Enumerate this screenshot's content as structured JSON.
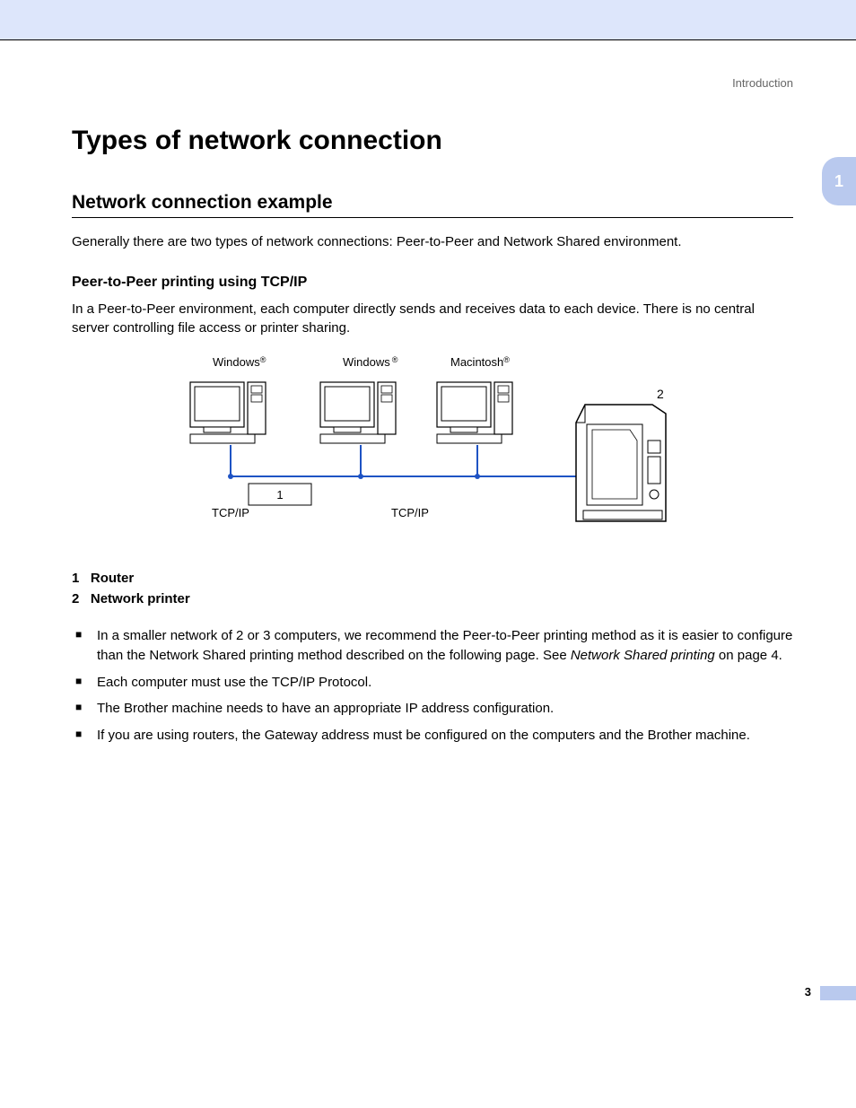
{
  "header": {
    "breadcrumb": "Introduction"
  },
  "side_tab": "1",
  "title": "Types of network connection",
  "section": {
    "heading": "Network connection example",
    "intro": "Generally there are two types of network connections: Peer-to-Peer and Network Shared environment."
  },
  "subsection": {
    "heading": "Peer-to-Peer printing using TCP/IP",
    "body": "In a Peer-to-Peer environment, each computer directly sends and receives data to each device. There is no central server controlling file access or printer sharing."
  },
  "diagram": {
    "labels": {
      "pc1": "Windows",
      "pc2": "Windows",
      "pc3": "Macintosh",
      "router_box": "1",
      "printer_callout": "2",
      "tcpip_left": "TCP/IP",
      "tcpip_right": "TCP/IP",
      "reg": "®"
    }
  },
  "legend": {
    "item1_num": "1",
    "item1_label": "Router",
    "item2_num": "2",
    "item2_label": "Network printer"
  },
  "bullets": {
    "b1a": "In a smaller network of 2 or 3 computers, we recommend the Peer-to-Peer printing method as it is easier to configure than the Network Shared printing method described on the following page. See ",
    "b1b": "Network Shared printing",
    "b1c": " on page 4.",
    "b2": "Each computer must use the TCP/IP Protocol.",
    "b3": "The Brother machine needs to have an appropriate IP address configuration.",
    "b4": "If you are using routers, the Gateway address must be configured on the computers and the Brother machine."
  },
  "page_number": "3"
}
